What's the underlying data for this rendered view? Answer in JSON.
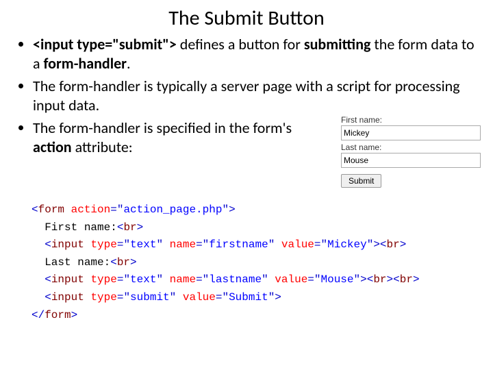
{
  "title": "The Submit Button",
  "bullets": {
    "b1_code": "<input type=\"submit\">",
    "b1_rest1": " defines a button for ",
    "b1_strong1": "submitting",
    "b1_rest2": " the form data to a ",
    "b1_strong2": "form-handler",
    "b1_rest3": ".",
    "b2": "The form-handler is typically a server page with a script for processing input data.",
    "b3_a": "The form-handler is specified in the form's ",
    "b3_strong": "action",
    "b3_b": " attribute:"
  },
  "form": {
    "label_first": "First name:",
    "value_first": "Mickey",
    "label_last": "Last name:",
    "value_last": "Mouse",
    "submit": "Submit"
  },
  "code": {
    "l1_a": "<",
    "l1_tag": "form",
    "l1_sp": " ",
    "l1_attr": "action",
    "l1_eq": "=\"",
    "l1_val": "action_page.php",
    "l1_q": "\"",
    "l1_c": ">",
    "l2_text": "First name:",
    "l2_br_o": "<",
    "l2_br_t": "br",
    "l2_br_c": ">",
    "l3_o": "<",
    "l3_tag": "input",
    "l3_sp": " ",
    "l3_a1": "type",
    "l3_e1": "=\"",
    "l3_v1": "text",
    "l3_q1": "\" ",
    "l3_a2": "name",
    "l3_e2": "=\"",
    "l3_v2": "firstname",
    "l3_q2": "\" ",
    "l3_a3": "value",
    "l3_e3": "=\"",
    "l3_v3": "Mickey",
    "l3_q3": "\"",
    "l3_c": "><",
    "l3_brt": "br",
    "l3_cc": ">",
    "l4_text": "Last name:",
    "l4_br_o": "<",
    "l4_br_t": "br",
    "l4_br_c": ">",
    "l5_o": "<",
    "l5_tag": "input",
    "l5_sp": " ",
    "l5_a1": "type",
    "l5_e1": "=\"",
    "l5_v1": "text",
    "l5_q1": "\" ",
    "l5_a2": "name",
    "l5_e2": "=\"",
    "l5_v2": "lastname",
    "l5_q2": "\" ",
    "l5_a3": "value",
    "l5_e3": "=\"",
    "l5_v3": "Mouse",
    "l5_q3": "\"",
    "l5_c": "><",
    "l5_brt": "br",
    "l5_cc": "><",
    "l5_brt2": "br",
    "l5_cc2": ">",
    "l6_o": "<",
    "l6_tag": "input",
    "l6_sp": " ",
    "l6_a1": "type",
    "l6_e1": "=\"",
    "l6_v1": "submit",
    "l6_q1": "\" ",
    "l6_a2": "value",
    "l6_e2": "=\"",
    "l6_v2": "Submit",
    "l6_q2": "\"",
    "l6_c": ">",
    "l7_o": "</",
    "l7_tag": "form",
    "l7_c": ">"
  }
}
